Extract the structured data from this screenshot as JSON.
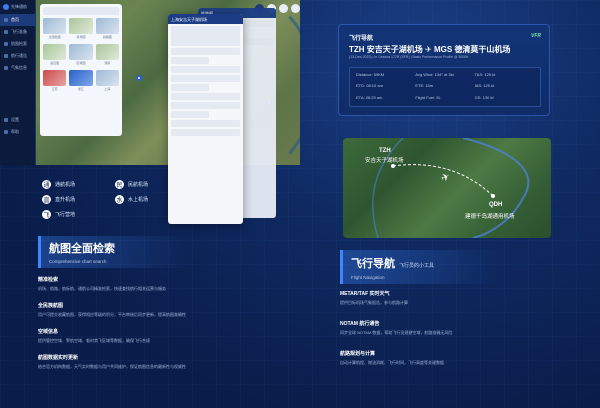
{
  "app": {
    "brand": "先锋通航",
    "sidebar": [
      "首页",
      "飞行准备",
      "航图检索",
      "航行通告",
      "气象信息",
      "设置",
      "帮助"
    ],
    "chart_labels": [
      "全国航图",
      "机场图",
      "航路图",
      "进近图",
      "区域图",
      "通用",
      "江苏",
      "浙江",
      "上海"
    ],
    "detail_title": "上海安吉天子湖机场",
    "back_title": "航路图"
  },
  "legend": {
    "items": [
      {
        "icon": "通",
        "label": "通航机场"
      },
      {
        "icon": "民",
        "label": "民航机场"
      },
      {
        "icon": "直",
        "label": "直升机场"
      },
      {
        "icon": "水",
        "label": "水上机场"
      },
      {
        "icon": "飞",
        "label": "飞行营地"
      }
    ]
  },
  "flight": {
    "title": "飞行导航",
    "rule": "VFR",
    "from_code": "TZH",
    "from_name": "安吉天子湖机场",
    "to_code": "MGS",
    "to_name": "德清莫干山机场",
    "subtitle": "(13-Dec-2023) | in Cessna 172R (SFR) | Basic Performance Profile @ 5000ft",
    "stats": [
      "Distance: 59KM",
      "Avg Wind: 134° at 3kt",
      "TAS: 125 kt",
      "ETD: 08:10 am",
      "ETE: 15m",
      "IAS: 125 kt",
      "ETA: 08:25 am",
      "Flight Fuel: 9L",
      "GS: 130 kt"
    ]
  },
  "map_preview": {
    "from_code": "TZH",
    "from_name": "安吉天子湖机场",
    "to_code": "QDH",
    "to_name": "建德千岛湖通用机场"
  },
  "section_left": {
    "title": "航图全面检索",
    "subtitle": "Comprehensive chart search",
    "features": [
      {
        "title": "精准检索",
        "desc": "机场、航路、航标航、通航公司精准检索，快速查找航行相关运营与服务"
      },
      {
        "title": "全民族航图",
        "desc": "用户可提交收藏航图，获得相应等级的积分，平台审核后同步更新，提高航图准确性"
      },
      {
        "title": "空域信息",
        "desc": "提供管控空域、警航空域、临时禁飞区域等数据，确保飞行合规"
      },
      {
        "title": "航图数据实时更新",
        "desc": "结合官方机构数据，天气实时数据与用户共同维护，保证航图信息的最新性与权威性"
      }
    ]
  },
  "section_right": {
    "title": "飞行导航",
    "title_small": "飞行员的小工具",
    "subtitle": "Flight Navigation",
    "features": [
      {
        "title": "METAR/TAF 实时天气",
        "desc": "提供目标机场气象报告，参与航路计算"
      },
      {
        "title": "NOTAM 航行通告",
        "desc": "同步全球 NOTAM 数据，帮助飞行员规避空域，航路准确无风险"
      },
      {
        "title": "航路规划与计算",
        "desc": "自动计算航程、燃油消耗、飞行时间，飞行高度等关键数据"
      }
    ]
  }
}
